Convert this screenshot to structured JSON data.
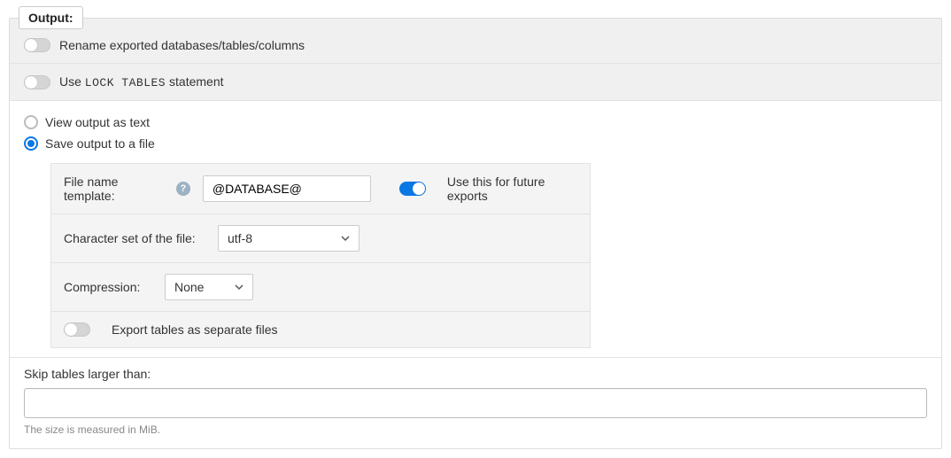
{
  "legend": "Output:",
  "rows": {
    "rename": {
      "label": "Rename exported databases/tables/columns",
      "checked": false
    },
    "lock": {
      "prefix": "Use ",
      "code": "LOCK TABLES",
      "suffix": " statement",
      "checked": false
    }
  },
  "output": {
    "view_text": "View output as text",
    "save_file": "Save output to a file",
    "selected": "save_file"
  },
  "file": {
    "template_label": "File name template:",
    "template_value": "@DATABASE@",
    "future_label": "Use this for future exports",
    "future_checked": true,
    "charset_label": "Character set of the file:",
    "charset_value": "utf-8",
    "compression_label": "Compression:",
    "compression_value": "None",
    "separate_label": "Export tables as separate files",
    "separate_checked": false
  },
  "skip": {
    "label": "Skip tables larger than:",
    "value": "",
    "hint": "The size is measured in MiB."
  }
}
